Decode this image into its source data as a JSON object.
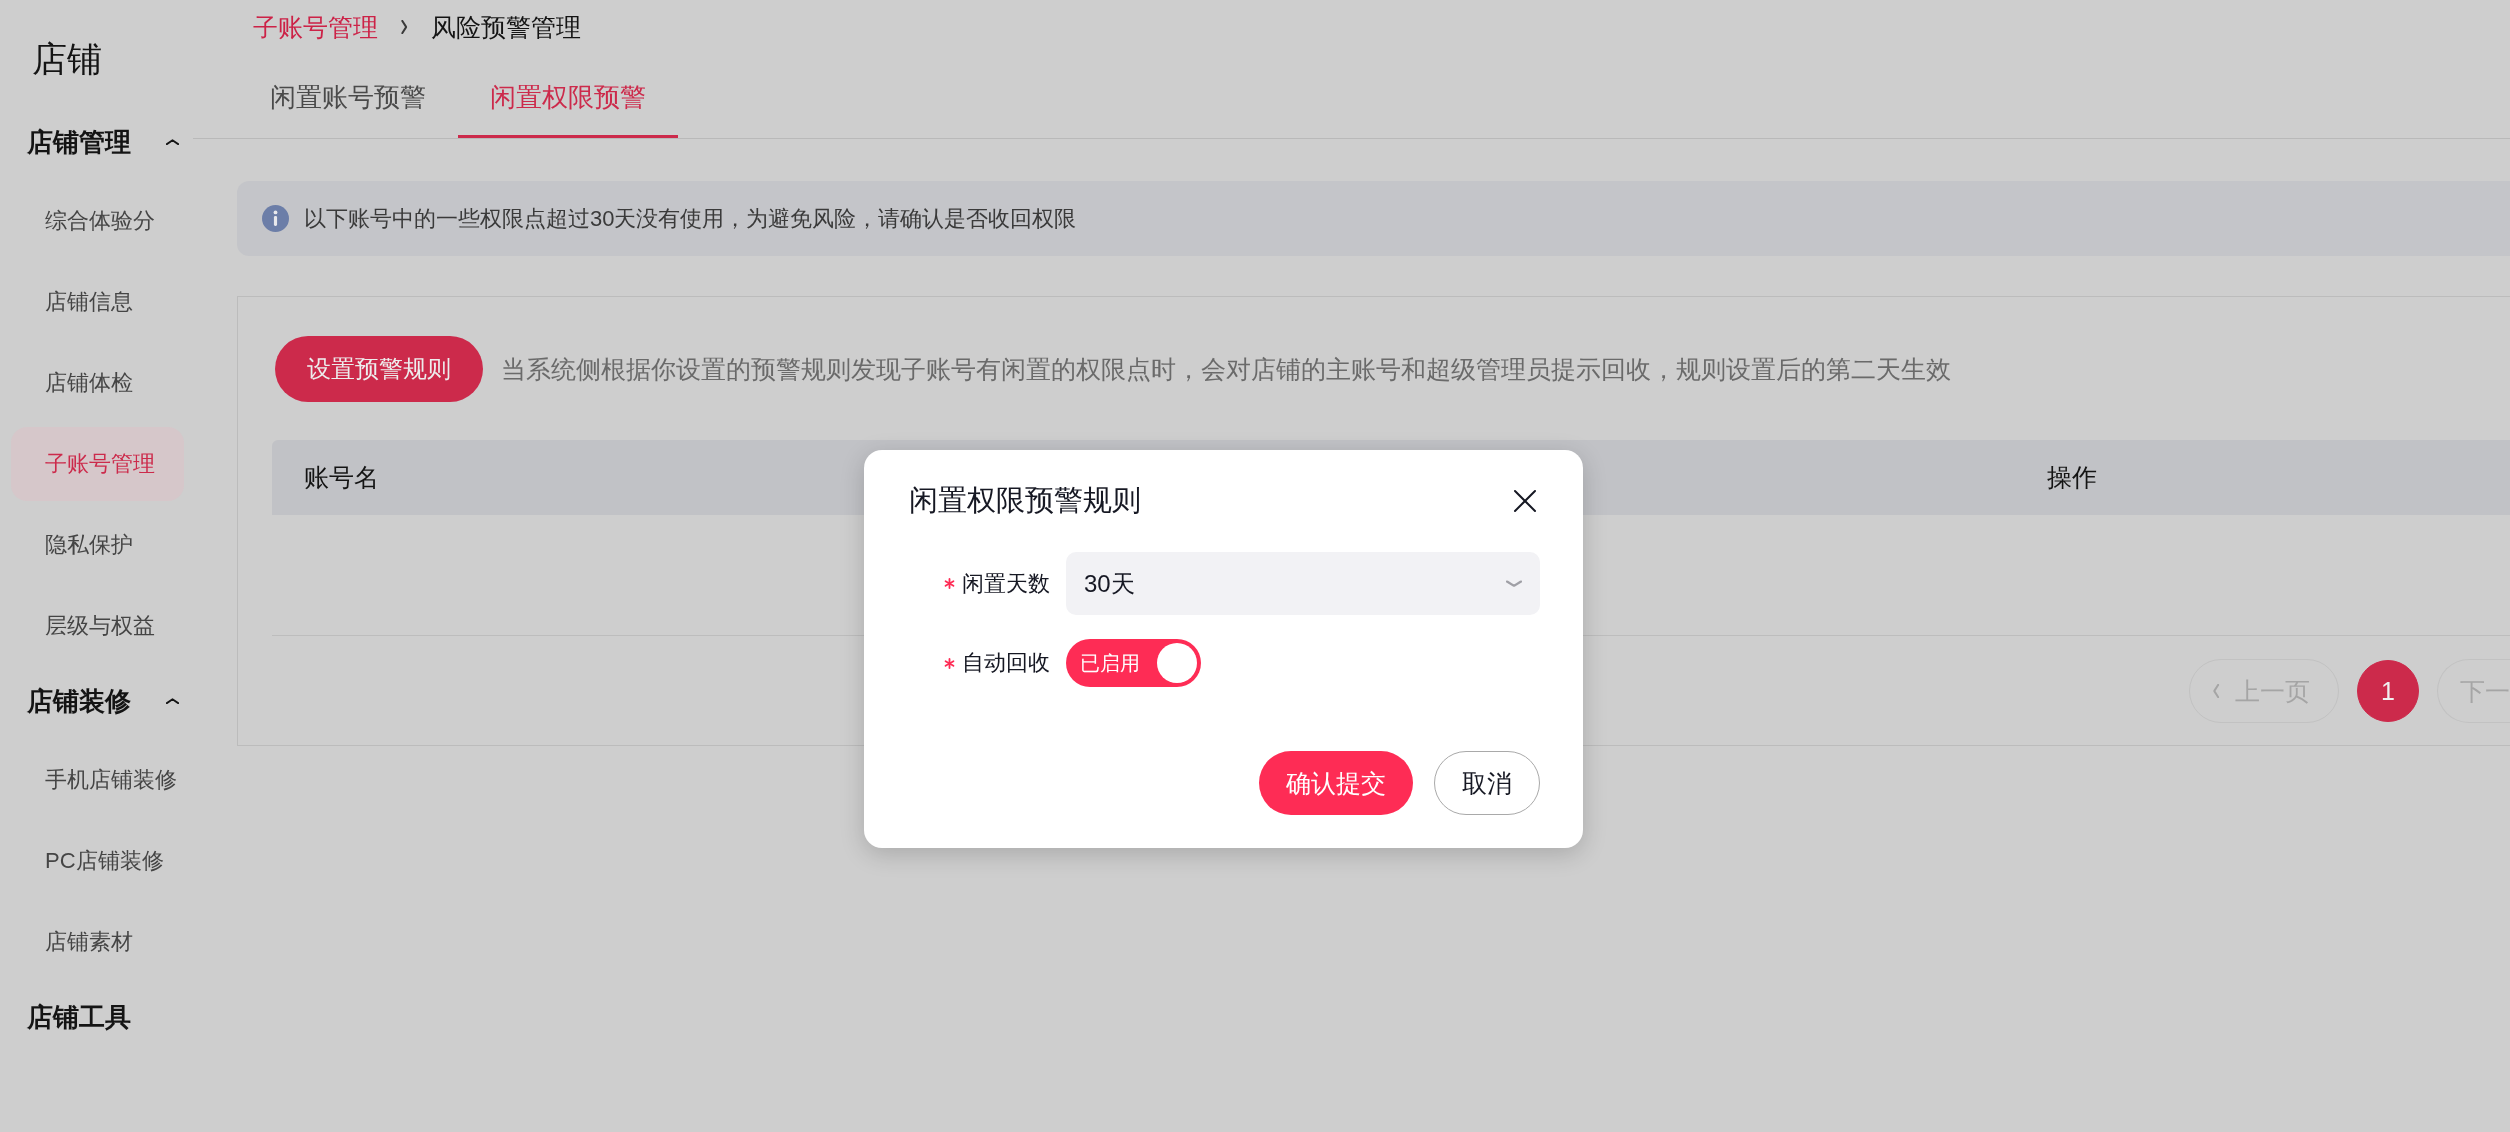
{
  "sidebar": {
    "title": "店铺",
    "sections": [
      {
        "kind": "group",
        "label": "店铺管理",
        "expanded": true,
        "items": [
          {
            "label": "综合体验分",
            "selected": false
          },
          {
            "label": "店铺信息",
            "selected": false
          },
          {
            "label": "店铺体检",
            "selected": false
          },
          {
            "label": "子账号管理",
            "selected": true
          },
          {
            "label": "隐私保护",
            "selected": false
          },
          {
            "label": "层级与权益",
            "selected": false
          }
        ]
      },
      {
        "kind": "group",
        "label": "店铺装修",
        "expanded": true,
        "items": [
          {
            "label": "手机店铺装修",
            "selected": false
          },
          {
            "label": "PC店铺装修",
            "selected": false
          },
          {
            "label": "店铺素材",
            "selected": false
          }
        ]
      },
      {
        "kind": "link",
        "label": "店铺工具"
      }
    ]
  },
  "breadcrumb": [
    {
      "kind": "link",
      "label": "子账号管理"
    },
    {
      "kind": "current",
      "label": "风险预警管理"
    }
  ],
  "tabs": [
    {
      "label": "闲置账号预警",
      "selected": false
    },
    {
      "label": "闲置权限预警",
      "selected": true
    }
  ],
  "notice": {
    "text": "以下账号中的一些权限点超过30天没有使用，为避免风险，请确认是否收回权限"
  },
  "rule_bar": {
    "button": "设置预警规则",
    "description": "当系统侧根据你设置的预警规则发现子账号有闲置的权限点时，会对店铺的主账号和超级管理员提示回收，规则设置后的第二天生效"
  },
  "table": {
    "columns": [
      "账号名",
      "操作"
    ]
  },
  "pagination": {
    "prev": {
      "label": "上一页",
      "disabled": true
    },
    "pages": [
      {
        "label": "1",
        "selected": true
      }
    ],
    "next": {
      "label": "下一",
      "disabled": true
    }
  },
  "modal": {
    "title": "闲置权限预警规则",
    "fields": [
      {
        "kind": "select",
        "label": "闲置天数",
        "required": true,
        "value": "30天"
      },
      {
        "kind": "switch",
        "label": "自动回收",
        "required": true,
        "on": true,
        "text": "已启用"
      }
    ],
    "buttons": [
      {
        "kind": "primary",
        "label": "确认提交"
      },
      {
        "kind": "secondary",
        "label": "取消"
      }
    ]
  }
}
